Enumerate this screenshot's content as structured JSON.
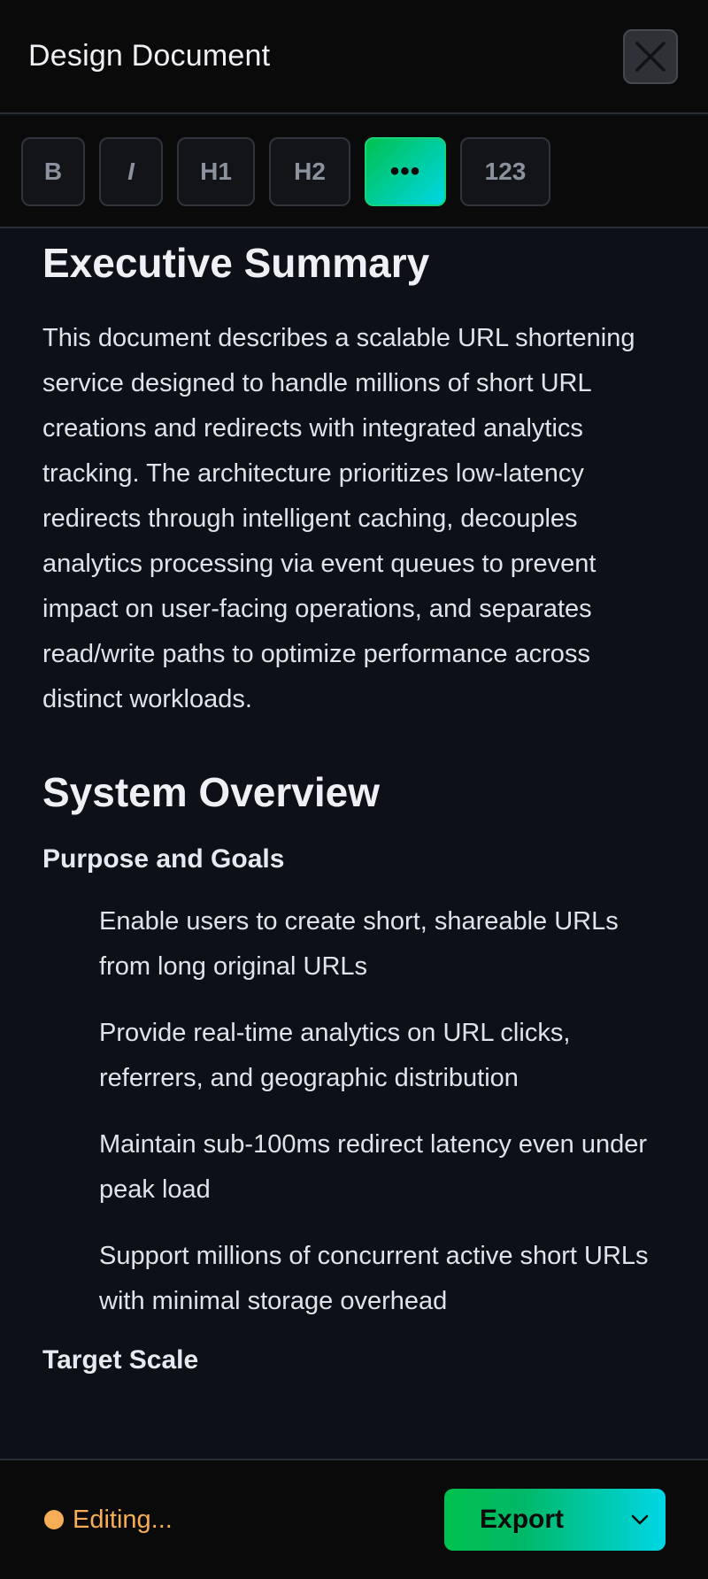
{
  "header": {
    "title": "Design Document",
    "close_icon": "close-icon"
  },
  "toolbar": {
    "bold_label": "B",
    "italic_label": "I",
    "h1_label": "H1",
    "h2_label": "H2",
    "more_label": "•••",
    "numbered_label": "123",
    "active_color": "#00c14f"
  },
  "content": {
    "executive_summary": {
      "heading": "Executive Summary",
      "body": "This document describes a scalable URL shortening service designed to handle millions of short URL creations and redirects with integrated analytics tracking. The architecture prioritizes low-latency redirects through intelligent caching, decouples analytics processing via event queues to prevent impact on user-facing operations, and separates read/write paths to optimize performance across distinct workloads."
    },
    "system_overview": {
      "heading": "System Overview",
      "purpose_heading": "Purpose and Goals",
      "goals": [
        "Enable users to create short, shareable URLs from long original URLs",
        "Provide real-time analytics on URL clicks, referrers, and geographic distribution",
        "Maintain sub-100ms redirect latency even under peak load",
        "Support millions of concurrent active short URLs with minimal storage overhead"
      ],
      "target_scale_heading": "Target Scale"
    }
  },
  "footer": {
    "status_text": "Editing...",
    "status_color": "#f6ad55",
    "export_label": "Export",
    "export_icon": "chevron-down-icon"
  }
}
